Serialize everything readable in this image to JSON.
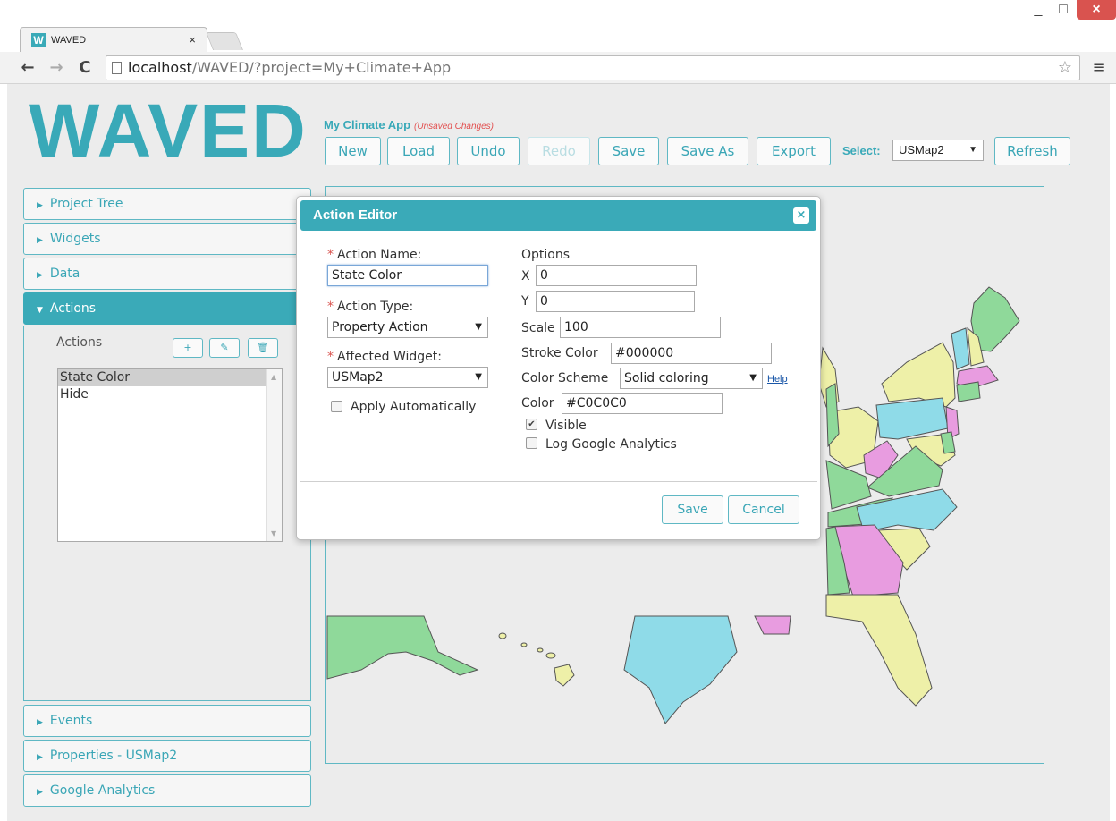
{
  "browser": {
    "tab_title": "WAVED",
    "tab_close": "×",
    "favicon": "W",
    "url_host": "localhost",
    "url_path": "/WAVED/?project=My+Climate+App",
    "window_min": "_",
    "window_max": "□",
    "window_close": "×",
    "back_glyph": "←",
    "forward_glyph": "→",
    "reload_glyph": "C",
    "star_glyph": "☆",
    "menu_glyph": "≡"
  },
  "app": {
    "logo": "WAVED",
    "project_name": "My Climate App",
    "unsaved": "(Unsaved Changes)",
    "toolbar": {
      "new": "New",
      "load": "Load",
      "undo": "Undo",
      "redo": "Redo",
      "save": "Save",
      "save_as": "Save As",
      "export": "Export",
      "select_label": "Select:",
      "select_value": "USMap2",
      "refresh": "Refresh"
    },
    "sidebar": {
      "project_tree": "Project Tree",
      "widgets": "Widgets",
      "data": "Data",
      "actions": "Actions",
      "events": "Events",
      "properties": "Properties - USMap2",
      "google_analytics": "Google Analytics"
    },
    "actions_panel": {
      "label": "Actions",
      "add": "+",
      "edit": "✎",
      "delete": "🗑",
      "items": [
        "State Color",
        "Hide"
      ]
    },
    "colors": {
      "accent": "#3aaab8",
      "map_green": "#8fd99a",
      "map_blue": "#8fdbe8",
      "map_yellow": "#eef0a8",
      "map_pink": "#e89ce0",
      "required": "#d9534f"
    }
  },
  "dialog": {
    "title": "Action Editor",
    "close": "×",
    "action_name_label": "Action Name:",
    "action_name_value": "State Color",
    "action_type_label": "Action Type:",
    "action_type_value": "Property Action",
    "affected_widget_label": "Affected Widget:",
    "affected_widget_value": "USMap2",
    "apply_automatically": "Apply Automatically",
    "options_label": "Options",
    "x_label": "X",
    "x_value": "0",
    "y_label": "Y",
    "y_value": "0",
    "scale_label": "Scale",
    "scale_value": "100",
    "stroke_color_label": "Stroke Color",
    "stroke_color_value": "#000000",
    "color_scheme_label": "Color Scheme",
    "color_scheme_value": "Solid coloring",
    "help": "Help",
    "color_label": "Color",
    "color_value": "#C0C0C0",
    "visible": "Visible",
    "visible_checked": true,
    "log_ga": "Log Google Analytics",
    "log_ga_checked": false,
    "apply_checked": false,
    "save": "Save",
    "cancel": "Cancel"
  }
}
